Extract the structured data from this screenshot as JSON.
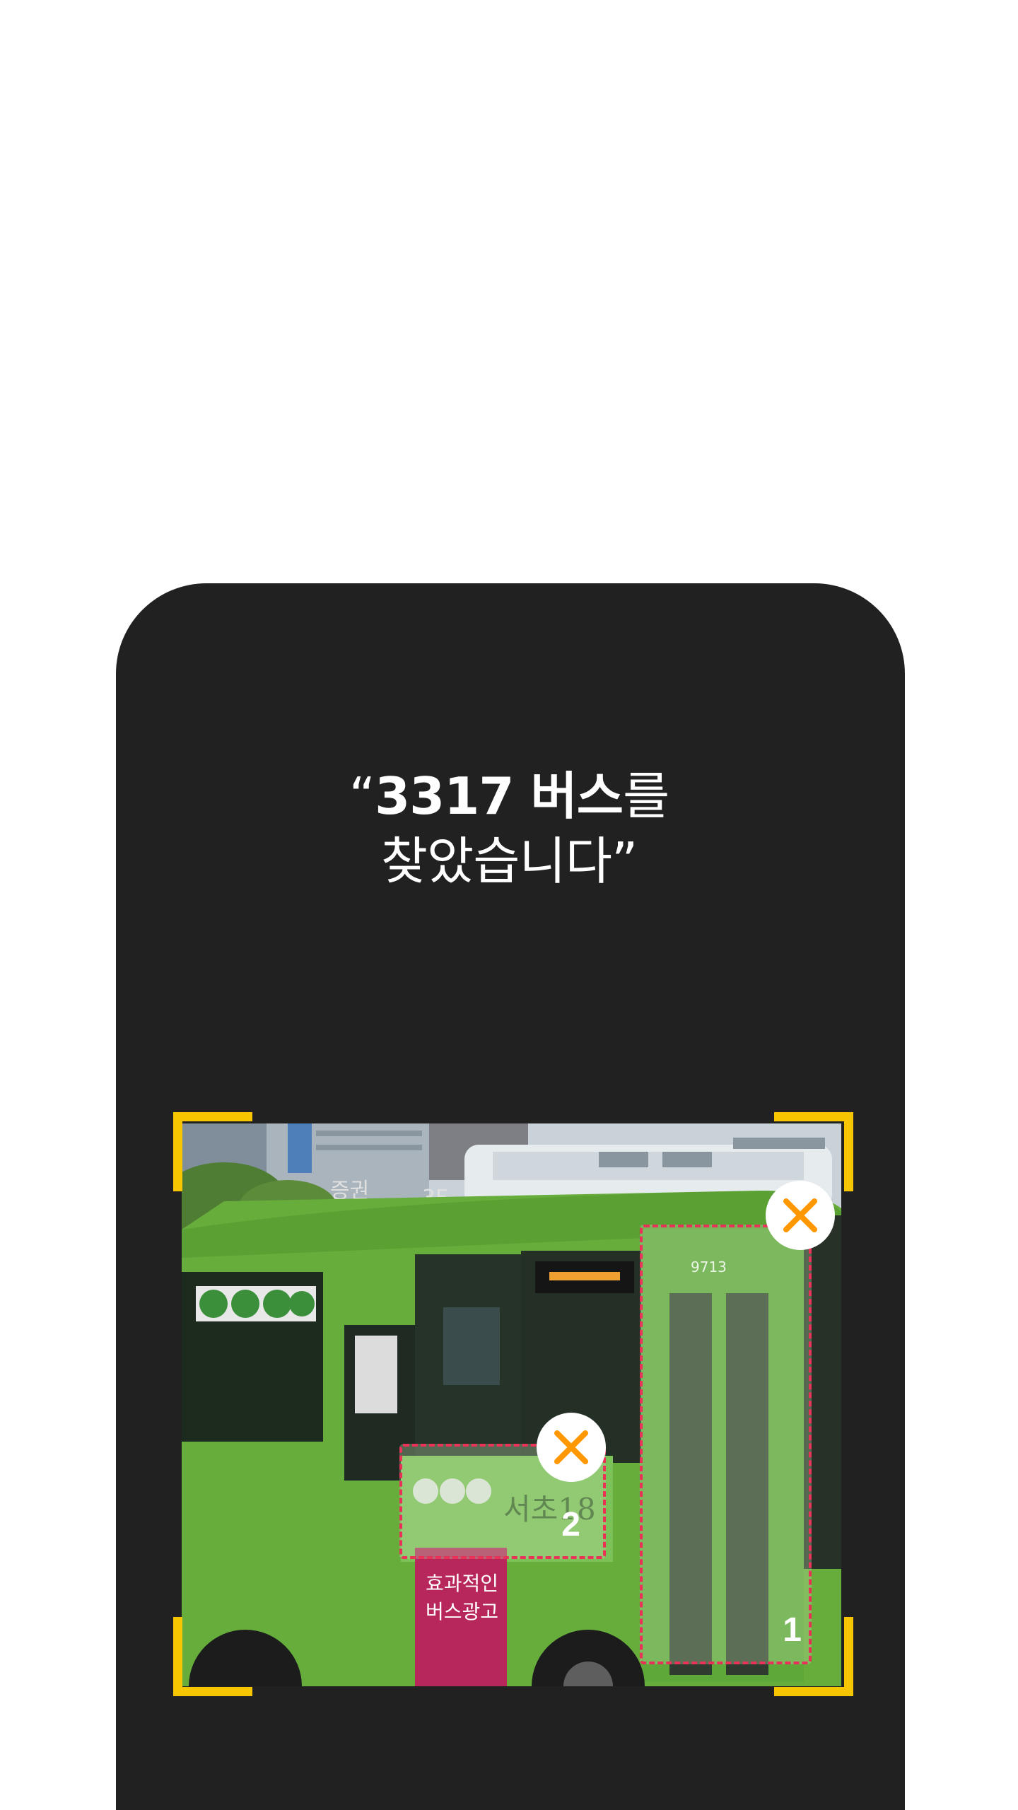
{
  "result": {
    "quote_open": "“",
    "bus_number_strong": "3317 버스",
    "particle": "를",
    "line2": "찾았습니다",
    "quote_close": "”"
  },
  "detections": [
    {
      "label": "1",
      "remove_icon": "close-icon"
    },
    {
      "label": "2",
      "remove_icon": "close-icon"
    }
  ],
  "photo": {
    "bus_plate": "9713",
    "route_sign": "서초18",
    "ad_text": "효과적인 버스광고",
    "building_text": "증권"
  },
  "colors": {
    "background": "#ffffff",
    "panel": "#212121",
    "frame_corner": "#f7c600",
    "detection_border": "#ea3158",
    "close_icon": "#ff9800"
  }
}
